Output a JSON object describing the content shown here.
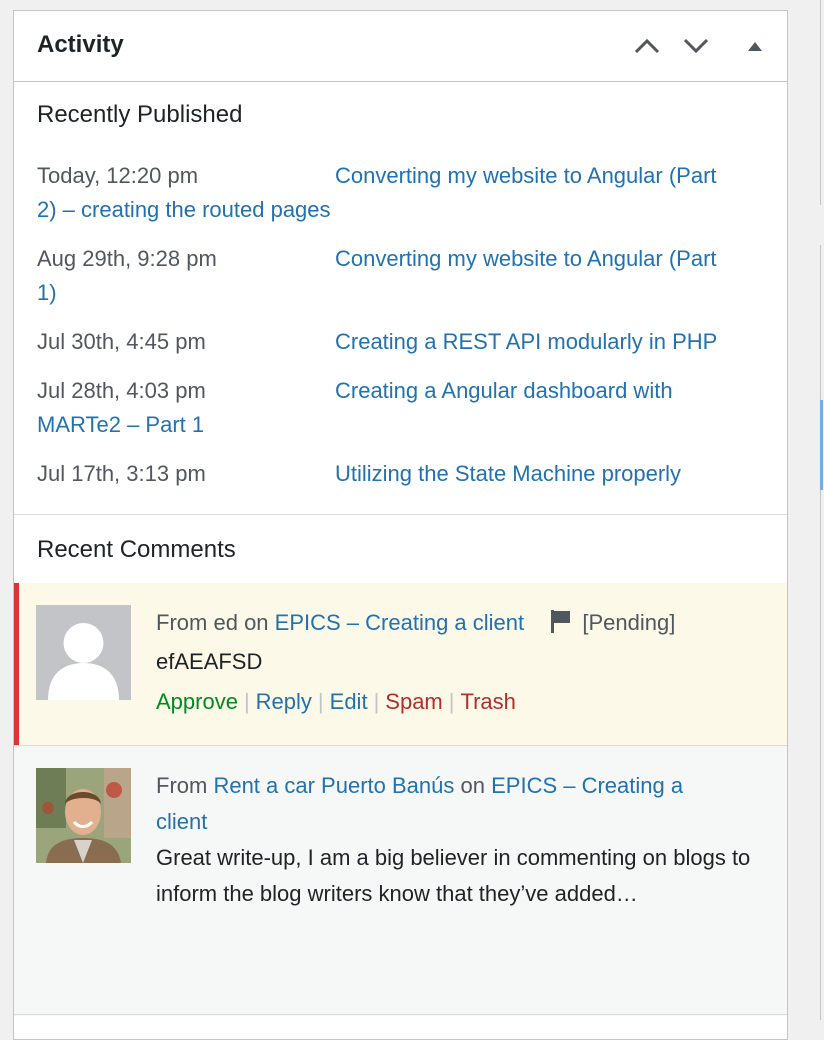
{
  "widget": {
    "title": "Activity",
    "controls": [
      "move-up",
      "move-down",
      "toggle-panel"
    ]
  },
  "recently_published": {
    "heading": "Recently Published",
    "items": [
      {
        "date": "Today, 12:20 pm",
        "title_line1": "Converting my website to Angular (Part",
        "title_line2": "2) – creating the routed pages"
      },
      {
        "date": "Aug 29th, 9:28 pm",
        "title_line1": "Converting my website to Angular (Part",
        "title_line2": "1)"
      },
      {
        "date": "Jul 30th, 4:45 pm",
        "title_line1": "Creating a REST API modularly in PHP",
        "title_line2": ""
      },
      {
        "date": "Jul 28th, 4:03 pm",
        "title_line1": "Creating a Angular dashboard with",
        "title_line2": "MARTe2 – Part 1"
      },
      {
        "date": "Jul 17th, 3:13 pm",
        "title_line1": "Utilizing the State Machine properly",
        "title_line2": ""
      }
    ]
  },
  "recent_comments": {
    "heading": "Recent Comments",
    "items": [
      {
        "from_label": "From",
        "author": "ed",
        "on_label": "on",
        "post": "EPICS – Creating a client",
        "status": "[Pending]",
        "text": "efAEAFSD",
        "actions": {
          "approve": "Approve",
          "reply": "Reply",
          "edit": "Edit",
          "spam": "Spam",
          "trash": "Trash"
        }
      },
      {
        "from_label": "From",
        "author": "Rent a car Puerto Banús",
        "on_label": "on",
        "post_line1": "EPICS – Creating a",
        "post_line2": "client",
        "text": "Great write-up, I am a big believer in commenting on blogs to inform the blog writers know that they’ve added…"
      }
    ]
  },
  "colors": {
    "link": "#2271b1",
    "approve": "#008a20",
    "spam": "#b32d2e",
    "pending_bg": "#fcf9e8",
    "pending_border": "#d63638"
  }
}
